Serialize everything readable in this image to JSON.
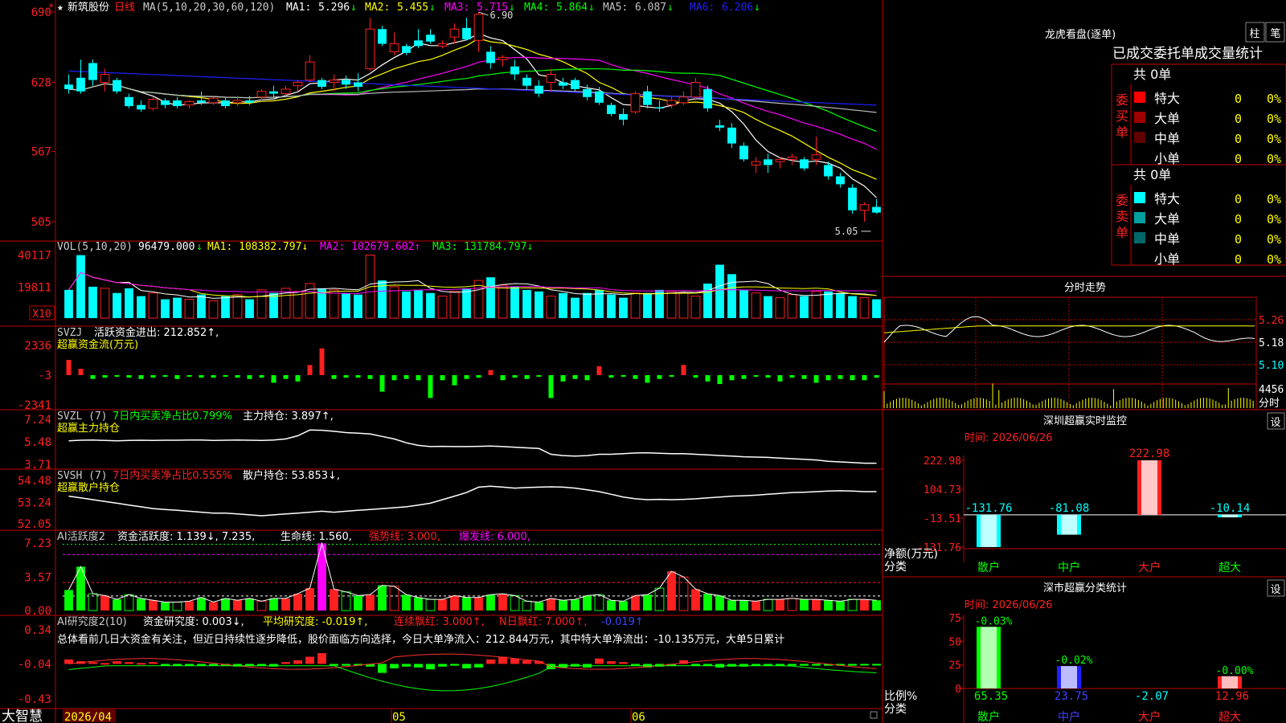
{
  "colors": {
    "up": "#ff2020",
    "down": "#00ffff",
    "green": "#00ff00",
    "ma1": "#ffffff",
    "ma2": "#ffff00",
    "ma3": "#ff00ff",
    "ma4": "#00ff00",
    "ma5": "#c0c0c0",
    "ma6": "#2020ff",
    "frame": "#c00000",
    "yellow": "#ffff00",
    "cyan": "#00ffff",
    "gray": "#c0c0c0"
  },
  "main_panel": {
    "star": "★",
    "stock_name": "新筑股份",
    "period": "日线",
    "ma_prefix": "MA(5,10,20,30,60,120)",
    "ma": [
      {
        "label": "MA1:",
        "value": "5.296",
        "arrow": "↓",
        "color": "#ffffff"
      },
      {
        "label": "MA2:",
        "value": "5.455",
        "arrow": "↓",
        "color": "#ffff00"
      },
      {
        "label": "MA3:",
        "value": "5.715",
        "arrow": "↓",
        "color": "#ff00ff"
      },
      {
        "label": "MA4:",
        "value": "5.864",
        "arrow": "↓",
        "color": "#00ff00"
      },
      {
        "label": "MA5:",
        "value": "6.087",
        "arrow": "↓",
        "color": "#c0c0c0"
      },
      {
        "label": "MA6:",
        "value": "6.206",
        "arrow": "↓",
        "color": "#2020ff"
      }
    ],
    "y_ticks": [
      "690",
      "628",
      "567",
      "505"
    ],
    "high_mark": "6.90",
    "low_mark": "5.05"
  },
  "vol_panel": {
    "prefix": "VOL(5,10,20)",
    "value": "96479.000",
    "value_arrow": "↓",
    "ma1": "MA1: 108382.797↓",
    "ma2": "MA2: 102679.602↑",
    "ma3": "MA3: 131784.797↓",
    "y_ticks": [
      "40117",
      "19811"
    ],
    "unit": "X10"
  },
  "svzj_panel": {
    "name": "SVZJ",
    "label1": "活跃资金进出: 212.852↑,",
    "label2": "超赢资金流(万元)",
    "y_ticks": [
      "2336",
      "-3",
      "-2341"
    ]
  },
  "svzl_panel": {
    "name": "SVZL (7)",
    "pct": "7日内买卖净占比0.799%",
    "pos": "主力持仓: 3.897↑,",
    "label2": "超赢主力持仓",
    "y_ticks": [
      "7.24",
      "5.48",
      "3.71"
    ]
  },
  "svsh_panel": {
    "name": "SVSH (7)",
    "pct": "7日内买卖净占比0.555%",
    "pos": "散户持仓: 53.853↓,",
    "label2": "超赢散户持仓",
    "y_ticks": [
      "54.48",
      "53.24",
      "52.05"
    ]
  },
  "ai_active_panel": {
    "name": "AI活跃度2",
    "a": "资金活跃度: 1.139↓, 7.235,",
    "b": "生命线: 1.560,",
    "c": "强势线: 3.000,",
    "d": "爆发线: 6.000,",
    "y_ticks": [
      "7.23",
      "3.57",
      "0.00"
    ]
  },
  "ai_research_panel": {
    "name": "AI研究度2(10)",
    "a": "资金研究度: 0.003↓,",
    "b": "平均研究度: -0.019↑,",
    "c": "连续飘红: 3.000↑,",
    "d": "N日飘红: 7.000↑,",
    "e": "-0.019↑",
    "comment": "总体看前几日大资金有关注，但近日持续性逐步降低，股价面临方向选择，今日大单净流入：212.844万元，其中特大单净流出：-10.135万元，大单5日累计",
    "y_ticks": [
      "0.34",
      "-0.04",
      "-0.43"
    ]
  },
  "bottom_bar": {
    "brand": "大智慧",
    "date_start": "2026/04",
    "month_05": "05",
    "month_06": "06"
  },
  "dragon_tiger": {
    "title": "龙虎看盘(逐单)",
    "btn_zhu": "柱",
    "btn_bi": "笔",
    "subtitle": "已成交委托单成交量统计",
    "buy": {
      "total": "共 0单",
      "side": "委买单",
      "rows": [
        {
          "name": "特大",
          "count": "0",
          "pct": "0%",
          "color": "#ff0000"
        },
        {
          "name": "大单",
          "count": "0",
          "pct": "0%",
          "color": "#a00000"
        },
        {
          "name": "中单",
          "count": "0",
          "pct": "0%",
          "color": "#600000"
        },
        {
          "name": "小单",
          "count": "0",
          "pct": "0%",
          "color": ""
        }
      ]
    },
    "sell": {
      "total": "共 0单",
      "side": "委卖单",
      "rows": [
        {
          "name": "特大",
          "count": "0",
          "pct": "0%",
          "color": "#00ffff"
        },
        {
          "name": "大单",
          "count": "0",
          "pct": "0%",
          "color": "#00a0a0"
        },
        {
          "name": "中单",
          "count": "0",
          "pct": "0%",
          "color": "#006868"
        },
        {
          "name": "小单",
          "count": "0",
          "pct": "0%",
          "color": ""
        }
      ]
    }
  },
  "intraday": {
    "title": "分时走势",
    "y_ticks": [
      "5.26",
      "5.18",
      "5.10"
    ],
    "vol_tick": "4456",
    "vol_label": "分时"
  },
  "sz_monitor": {
    "title": "深圳超赢实时监控",
    "btn": "设",
    "time_label": "时间: 2026/06/26",
    "y_ticks": [
      "222.98",
      "104.73",
      "-13.51",
      "-131.76"
    ],
    "bars": [
      {
        "cat": "散户",
        "value": "-131.76"
      },
      {
        "cat": "中户",
        "value": "-81.08"
      },
      {
        "cat": "大户",
        "value": "222.98"
      },
      {
        "cat": "超大",
        "value": "-10.14"
      }
    ],
    "axis_label1": "净额(万元)",
    "axis_label2": "分类"
  },
  "sz_classify": {
    "title": "深市超赢分类统计",
    "btn": "设",
    "time_label": "时间: 2026/06/26",
    "y_ticks": [
      "75",
      "50",
      "25",
      "0"
    ],
    "bars": [
      {
        "cat": "散户",
        "ratio": "65.35",
        "change": "-0.03%"
      },
      {
        "cat": "中户",
        "ratio": "23.75",
        "change": "-0.02%"
      },
      {
        "cat": "大户",
        "ratio": "-2.07",
        "change": ""
      },
      {
        "cat": "超大",
        "ratio": "12.96",
        "change": "-0.00%"
      }
    ],
    "axis_label1": "比例%",
    "axis_label2": "分类"
  },
  "chart_data": [
    {
      "type": "candlestick",
      "title": "新筑股份 日线",
      "ylim": [
        4.95,
        6.95
      ],
      "high": 6.9,
      "low": 5.05,
      "candles": [
        [
          6.26,
          6.35,
          6.18,
          6.22
        ],
        [
          6.32,
          6.48,
          6.18,
          6.2
        ],
        [
          6.45,
          6.48,
          6.25,
          6.3
        ],
        [
          6.28,
          6.4,
          6.2,
          6.35
        ],
        [
          6.3,
          6.32,
          6.18,
          6.2
        ],
        [
          6.15,
          6.18,
          6.05,
          6.07
        ],
        [
          6.08,
          6.12,
          6.02,
          6.04
        ],
        [
          6.05,
          6.15,
          6.03,
          6.13
        ],
        [
          6.12,
          6.14,
          6.05,
          6.08
        ],
        [
          6.12,
          6.15,
          6.05,
          6.07
        ],
        [
          6.08,
          6.12,
          6.05,
          6.11
        ],
        [
          6.12,
          6.2,
          6.08,
          6.1
        ],
        [
          6.1,
          6.15,
          6.08,
          6.14
        ],
        [
          6.12,
          6.15,
          6.05,
          6.07
        ],
        [
          6.1,
          6.16,
          6.07,
          6.12
        ],
        [
          6.12,
          6.16,
          6.08,
          6.1
        ],
        [
          6.15,
          6.22,
          6.12,
          6.2
        ],
        [
          6.2,
          6.25,
          6.15,
          6.18
        ],
        [
          6.18,
          6.25,
          6.16,
          6.22
        ],
        [
          6.25,
          6.3,
          6.2,
          6.28
        ],
        [
          6.3,
          6.52,
          6.28,
          6.46
        ],
        [
          6.3,
          6.32,
          6.22,
          6.24
        ],
        [
          6.28,
          6.35,
          6.2,
          6.3
        ],
        [
          6.3,
          6.34,
          6.22,
          6.26
        ],
        [
          6.28,
          6.36,
          6.2,
          6.24
        ],
        [
          6.4,
          6.85,
          6.38,
          6.75
        ],
        [
          6.75,
          6.78,
          6.6,
          6.62
        ],
        [
          6.55,
          6.72,
          6.52,
          6.62
        ],
        [
          6.6,
          6.62,
          6.52,
          6.54
        ],
        [
          6.65,
          6.75,
          6.58,
          6.6
        ],
        [
          6.7,
          6.75,
          6.62,
          6.64
        ],
        [
          6.6,
          6.65,
          6.58,
          6.62
        ],
        [
          6.68,
          6.8,
          6.62,
          6.75
        ],
        [
          6.76,
          6.85,
          6.65,
          6.66
        ],
        [
          6.65,
          6.9,
          6.55,
          6.88
        ],
        [
          6.55,
          6.6,
          6.4,
          6.45
        ],
        [
          6.48,
          6.52,
          6.42,
          6.5
        ],
        [
          6.42,
          6.48,
          6.3,
          6.35
        ],
        [
          6.32,
          6.35,
          6.22,
          6.25
        ],
        [
          6.25,
          6.3,
          6.15,
          6.18
        ],
        [
          6.28,
          6.4,
          6.2,
          6.35
        ],
        [
          6.28,
          6.32,
          6.22,
          6.25
        ],
        [
          6.3,
          6.32,
          6.2,
          6.22
        ],
        [
          6.22,
          6.26,
          6.12,
          6.15
        ],
        [
          6.2,
          6.24,
          6.08,
          6.1
        ],
        [
          6.08,
          6.1,
          5.98,
          6.0
        ],
        [
          6.0,
          6.05,
          5.9,
          5.95
        ],
        [
          6.02,
          6.2,
          6.0,
          6.18
        ],
        [
          6.2,
          6.25,
          6.05,
          6.08
        ],
        [
          6.06,
          6.12,
          6.02,
          6.05
        ],
        [
          6.08,
          6.15,
          6.05,
          6.12
        ],
        [
          6.1,
          6.2,
          6.08,
          6.15
        ],
        [
          6.15,
          6.32,
          6.12,
          6.28
        ],
        [
          6.22,
          6.25,
          6.02,
          6.05
        ],
        [
          5.9,
          5.95,
          5.85,
          5.88
        ],
        [
          5.88,
          5.92,
          5.7,
          5.74
        ],
        [
          5.72,
          5.75,
          5.58,
          5.6
        ],
        [
          5.55,
          5.62,
          5.48,
          5.58
        ],
        [
          5.6,
          5.65,
          5.48,
          5.55
        ],
        [
          5.58,
          5.62,
          5.52,
          5.6
        ],
        [
          5.6,
          5.65,
          5.55,
          5.62
        ],
        [
          5.6,
          5.62,
          5.5,
          5.52
        ],
        [
          5.6,
          5.8,
          5.55,
          5.64
        ],
        [
          5.55,
          5.58,
          5.42,
          5.45
        ],
        [
          5.45,
          5.48,
          5.35,
          5.38
        ],
        [
          5.35,
          5.38,
          5.12,
          5.15
        ],
        [
          5.15,
          5.22,
          5.05,
          5.2
        ],
        [
          5.18,
          5.25,
          5.12,
          5.13
        ]
      ]
    },
    {
      "type": "bar",
      "title": "VOL(5,10,20)",
      "ylim": [
        0,
        44000
      ],
      "values": [
        18000,
        40117,
        20000,
        19000,
        16000,
        19000,
        14000,
        16000,
        12000,
        13000,
        12000,
        15000,
        11000,
        14000,
        15000,
        12000,
        18000,
        16000,
        19000,
        17000,
        22000,
        19000,
        18000,
        16000,
        15000,
        40117,
        24000,
        20000,
        17000,
        18000,
        16000,
        14000,
        17000,
        19000,
        24000,
        26000,
        21000,
        20000,
        18000,
        17000,
        14000,
        16000,
        13000,
        16000,
        18000,
        15000,
        13000,
        16000,
        16000,
        18000,
        17000,
        16000,
        14000,
        22000,
        34000,
        28000,
        18000,
        16000,
        14000,
        13000,
        15000,
        14000,
        17000,
        17000,
        16000,
        14000,
        13000,
        12000
      ]
    },
    {
      "type": "bar",
      "title": "SVZJ",
      "ylim": [
        -2341,
        2336
      ],
      "values": [
        1200,
        500,
        -300,
        -200,
        -100,
        -200,
        -300,
        -200,
        -100,
        -300,
        -100,
        -200,
        -200,
        -100,
        -200,
        -300,
        -200,
        -600,
        -300,
        -500,
        800,
        2100,
        -300,
        -200,
        -200,
        -300,
        -1300,
        -400,
        -300,
        -400,
        -1800,
        -400,
        -800,
        -300,
        -200,
        400,
        -400,
        -200,
        -300,
        -100,
        -1800,
        -500,
        -300,
        -400,
        700,
        -200,
        -100,
        -300,
        -600,
        -300,
        -100,
        800,
        -200,
        -500,
        -700,
        -400,
        -300,
        -100,
        -200,
        -500,
        -200,
        -300,
        -600,
        -400,
        -300,
        -400,
        -400,
        -200
      ]
    },
    {
      "type": "line",
      "title": "SVZL",
      "ylim": [
        3.71,
        7.24
      ],
      "values": [
        5.55,
        5.6,
        5.62,
        5.58,
        5.55,
        5.58,
        5.6,
        5.58,
        5.6,
        5.6,
        5.62,
        5.62,
        5.58,
        5.6,
        5.62,
        5.6,
        5.58,
        5.62,
        5.7,
        5.95,
        6.4,
        6.38,
        6.3,
        6.2,
        6.15,
        6.1,
        5.9,
        5.7,
        5.4,
        5.2,
        5.1,
        5.12,
        5.1,
        5.1,
        5.12,
        5.15,
        5.1,
        5.05,
        5.0,
        4.95,
        4.5,
        4.4,
        4.35,
        4.4,
        4.5,
        4.5,
        4.55,
        4.6,
        4.62,
        4.58,
        4.55,
        4.55,
        4.5,
        4.45,
        4.4,
        4.35,
        4.3,
        4.28,
        4.25,
        4.2,
        4.15,
        4.1,
        4.05,
        3.95,
        3.9,
        3.85,
        3.8,
        3.8
      ]
    },
    {
      "type": "line",
      "title": "SVSH",
      "ylim": [
        52.05,
        54.48
      ],
      "values": [
        53.6,
        53.5,
        53.4,
        53.3,
        53.2,
        53.1,
        53.0,
        52.9,
        52.85,
        52.8,
        52.75,
        52.7,
        52.65,
        52.65,
        52.6,
        52.55,
        52.5,
        52.55,
        52.6,
        52.65,
        52.7,
        52.75,
        52.7,
        52.75,
        52.8,
        52.85,
        52.9,
        52.95,
        53.0,
        53.1,
        53.2,
        53.4,
        53.6,
        53.8,
        54.1,
        54.15,
        54.1,
        54.05,
        54.08,
        54.1,
        54.12,
        54.1,
        54.05,
        53.95,
        53.85,
        53.7,
        53.55,
        53.45,
        53.4,
        53.42,
        53.4,
        53.42,
        53.45,
        53.5,
        53.55,
        53.6,
        53.62,
        53.65,
        53.7,
        53.75,
        53.8,
        53.82,
        53.85,
        53.88,
        53.9,
        53.88,
        53.85,
        53.85
      ]
    },
    {
      "type": "bar",
      "title": "AI活跃度2",
      "ylim": [
        0,
        7.23
      ],
      "values": [
        2.2,
        4.7,
        1.8,
        1.6,
        1.2,
        1.7,
        1.3,
        1.1,
        0.9,
        0.9,
        1.0,
        1.4,
        0.9,
        1.3,
        1.1,
        1.3,
        1.0,
        1.3,
        1.3,
        1.8,
        2.4,
        7.2,
        2.3,
        2.0,
        1.6,
        1.7,
        2.7,
        2.6,
        1.7,
        1.4,
        1.2,
        1.2,
        1.6,
        1.4,
        1.4,
        1.7,
        1.8,
        1.6,
        1.0,
        0.9,
        1.3,
        1.1,
        1.2,
        1.6,
        1.7,
        1.1,
        1.0,
        1.6,
        1.7,
        2.4,
        4.2,
        3.6,
        2.3,
        1.8,
        1.6,
        1.1,
        1.1,
        1.0,
        1.2,
        1.2,
        1.3,
        1.2,
        1.2,
        1.1,
        1.0,
        1.2,
        1.2,
        1.1
      ]
    },
    {
      "type": "bar",
      "title": "AI研究度2(10)",
      "ylim": [
        -0.43,
        0.34
      ],
      "values": [
        0.05,
        0.03,
        0.02,
        0.01,
        0.03,
        0.02,
        0.01,
        0.02,
        -0.01,
        -0.02,
        -0.01,
        -0.02,
        -0.01,
        -0.02,
        -0.03,
        -0.01,
        -0.02,
        -0.03,
        0.02,
        0.04,
        0.08,
        0.12,
        -0.02,
        -0.02,
        -0.02,
        -0.03,
        -0.1,
        -0.05,
        -0.03,
        -0.04,
        -0.06,
        -0.03,
        -0.02,
        -0.05,
        -0.04,
        0.05,
        0.08,
        0.06,
        0.04,
        0.03,
        -0.06,
        -0.04,
        -0.03,
        -0.04,
        0.06,
        0.03,
        0.02,
        -0.02,
        -0.04,
        -0.03,
        -0.02,
        0.04,
        -0.02,
        -0.02,
        -0.04,
        -0.03,
        -0.03,
        -0.02,
        -0.02,
        -0.02,
        -0.02,
        -0.02,
        -0.02,
        -0.02,
        -0.02,
        -0.02,
        -0.01,
        -0.01
      ]
    }
  ]
}
